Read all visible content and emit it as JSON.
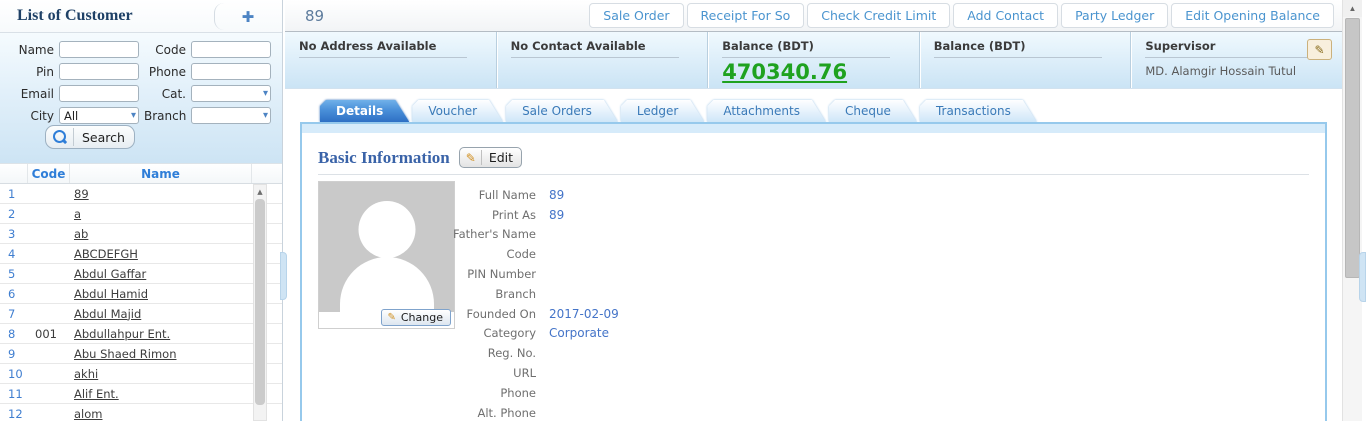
{
  "icons": {
    "add": "✚",
    "up_arrow": "▲",
    "pencil": "✎",
    "chevron_down": "▾"
  },
  "colors": {
    "accent_blue": "#3e7cc5",
    "balance_green": "#1fa21f",
    "active_tab_blue": "#2f6fc4",
    "panel_border_blue": "#96c9ec",
    "link_blue": "#4474c8"
  },
  "left_panel": {
    "title": "List of Customer",
    "search_form": {
      "fields": [
        {
          "label": "Name",
          "type": "text",
          "value": ""
        },
        {
          "label": "Code",
          "type": "text",
          "value": ""
        },
        {
          "label": "Pin",
          "type": "text",
          "value": ""
        },
        {
          "label": "Phone",
          "type": "text",
          "value": ""
        },
        {
          "label": "Email",
          "type": "text",
          "value": ""
        },
        {
          "label": "Cat.",
          "type": "select",
          "value": ""
        },
        {
          "label": "City",
          "type": "select",
          "value": "All"
        },
        {
          "label": "Branch",
          "type": "select",
          "value": ""
        }
      ],
      "search_label": "Search"
    },
    "table": {
      "headers": [
        "Code",
        "Name"
      ],
      "rows": [
        {
          "num": "1",
          "code": "",
          "name": "89"
        },
        {
          "num": "2",
          "code": "",
          "name": "a"
        },
        {
          "num": "3",
          "code": "",
          "name": "ab"
        },
        {
          "num": "4",
          "code": "",
          "name": "ABCDEFGH"
        },
        {
          "num": "5",
          "code": "",
          "name": "Abdul Gaffar"
        },
        {
          "num": "6",
          "code": "",
          "name": "Abdul Hamid"
        },
        {
          "num": "7",
          "code": "",
          "name": "Abdul Majid"
        },
        {
          "num": "8",
          "code": "001",
          "name": "Abdullahpur Ent."
        },
        {
          "num": "9",
          "code": "",
          "name": "Abu Shaed Rimon"
        },
        {
          "num": "10",
          "code": "",
          "name": "akhi"
        },
        {
          "num": "11",
          "code": "",
          "name": "Alif Ent."
        },
        {
          "num": "12",
          "code": "",
          "name": "alom"
        }
      ]
    }
  },
  "main": {
    "title": "89",
    "actions": [
      {
        "label": "Sale Order"
      },
      {
        "label": "Receipt For So"
      },
      {
        "label": "Check Credit Limit"
      },
      {
        "label": "Add Contact"
      },
      {
        "label": "Party Ledger"
      },
      {
        "label": "Edit Opening Balance"
      }
    ],
    "info_sections": [
      {
        "label": "No Address Available",
        "value": ""
      },
      {
        "label": "No Contact Available",
        "value": ""
      },
      {
        "label": "Balance (BDT)",
        "value": "470340.76",
        "emphasis": "big-green"
      },
      {
        "label": "Balance (BDT)",
        "value": ""
      },
      {
        "label": "Supervisor",
        "value": "MD. Alamgir Hossain Tutul",
        "editable": true
      }
    ],
    "tabs": [
      {
        "label": "Details",
        "active": true
      },
      {
        "label": "Voucher"
      },
      {
        "label": "Sale Orders"
      },
      {
        "label": "Ledger"
      },
      {
        "label": "Attachments"
      },
      {
        "label": "Cheque"
      },
      {
        "label": "Transactions"
      }
    ],
    "details": {
      "section_title": "Basic Information",
      "edit_label": "Edit",
      "change_label": "Change",
      "fields": [
        {
          "label": "Full Name",
          "value": "89"
        },
        {
          "label": "Print As",
          "value": "89"
        },
        {
          "label": "Father's Name",
          "value": ""
        },
        {
          "label": "Code",
          "value": ""
        },
        {
          "label": "PIN Number",
          "value": ""
        },
        {
          "label": "Branch",
          "value": ""
        },
        {
          "label": "Founded On",
          "value": "2017-02-09"
        },
        {
          "label": "Category",
          "value": "Corporate"
        },
        {
          "label": "Reg. No.",
          "value": ""
        },
        {
          "label": "URL",
          "value": ""
        },
        {
          "label": "Phone",
          "value": ""
        },
        {
          "label": "Alt. Phone",
          "value": ""
        }
      ]
    }
  }
}
